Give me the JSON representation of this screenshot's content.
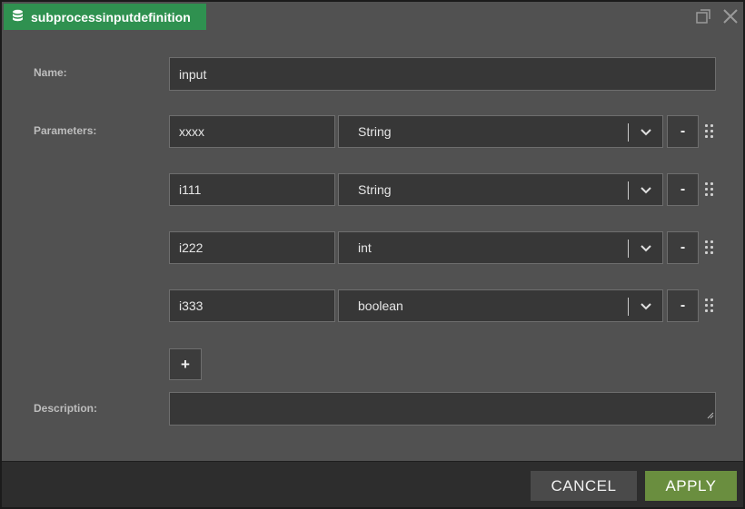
{
  "dialog": {
    "title": "subprocessinputdefinition",
    "title_icon": "database-icon",
    "controls": [
      "restore-window-icon",
      "close-icon"
    ]
  },
  "form": {
    "name_label": "Name:",
    "name_value": "input",
    "parameters_label": "Parameters:",
    "parameters": [
      {
        "name": "xxxx",
        "type": "String",
        "remove_label": "-"
      },
      {
        "name": "i111",
        "type": "String",
        "remove_label": "-"
      },
      {
        "name": "i222",
        "type": "int",
        "remove_label": "-"
      },
      {
        "name": "i333",
        "type": "boolean",
        "remove_label": "-"
      }
    ],
    "add_label": "+",
    "description_label": "Description:",
    "description_value": ""
  },
  "footer": {
    "cancel_label": "CANCEL",
    "apply_label": "APPLY"
  },
  "colors": {
    "title_tab": "#2f9150",
    "apply_button": "#6a8e3f",
    "dialog_bg": "#515151"
  }
}
